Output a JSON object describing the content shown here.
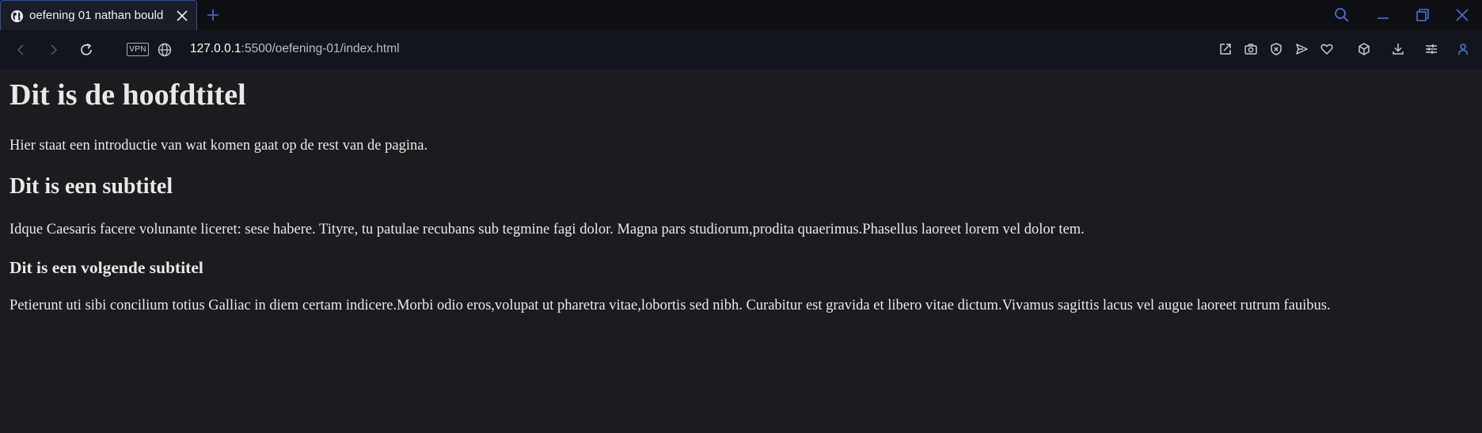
{
  "tab": {
    "title": "oefening 01 nathan bould",
    "favicon_icon": "globe-icon",
    "close_icon": "close-icon"
  },
  "new_tab_icon": "plus-icon",
  "window_controls": [
    "search-icon",
    "minimize-icon",
    "restore-icon",
    "close-icon"
  ],
  "navigation": {
    "back_icon": "back-arrow-icon",
    "forward_icon": "forward-arrow-icon",
    "reload_icon": "reload-icon",
    "vpn_label": "VPN",
    "site_info_icon": "globe-icon"
  },
  "address": {
    "host": "127.0.0.1",
    "path": ":5500/oefening-01/index.html"
  },
  "toolbar_icons": [
    "share-icon",
    "camera-icon",
    "shield-icon",
    "send-icon",
    "heart-icon",
    "cube-icon",
    "download-icon",
    "settings-sliders-icon",
    "account-icon"
  ],
  "colors": {
    "accent": "#2e4fa8",
    "page_background": "#1b1c1f",
    "text": "#e8e8e8"
  },
  "page": {
    "heading1": "Dit is de hoofdtitel",
    "paragraph1": "Hier staat een introductie van wat komen gaat op de rest van de pagina.",
    "heading2": "Dit is een subtitel",
    "paragraph2": "Idque Caesaris facere volunante liceret: sese habere. Tityre, tu patulae recubans sub tegmine fagi dolor. Magna pars studiorum,prodita quaerimus.Phasellus laoreet lorem vel dolor tem.",
    "heading3": "Dit is een volgende subtitel",
    "paragraph3": "Petierunt uti sibi concilium totius Galliac in diem certam indicere.Morbi odio eros,volupat ut pharetra vitae,lobortis sed nibh. Curabitur est gravida et libero vitae dictum.Vivamus sagittis lacus vel augue laoreet rutrum fauibus."
  }
}
